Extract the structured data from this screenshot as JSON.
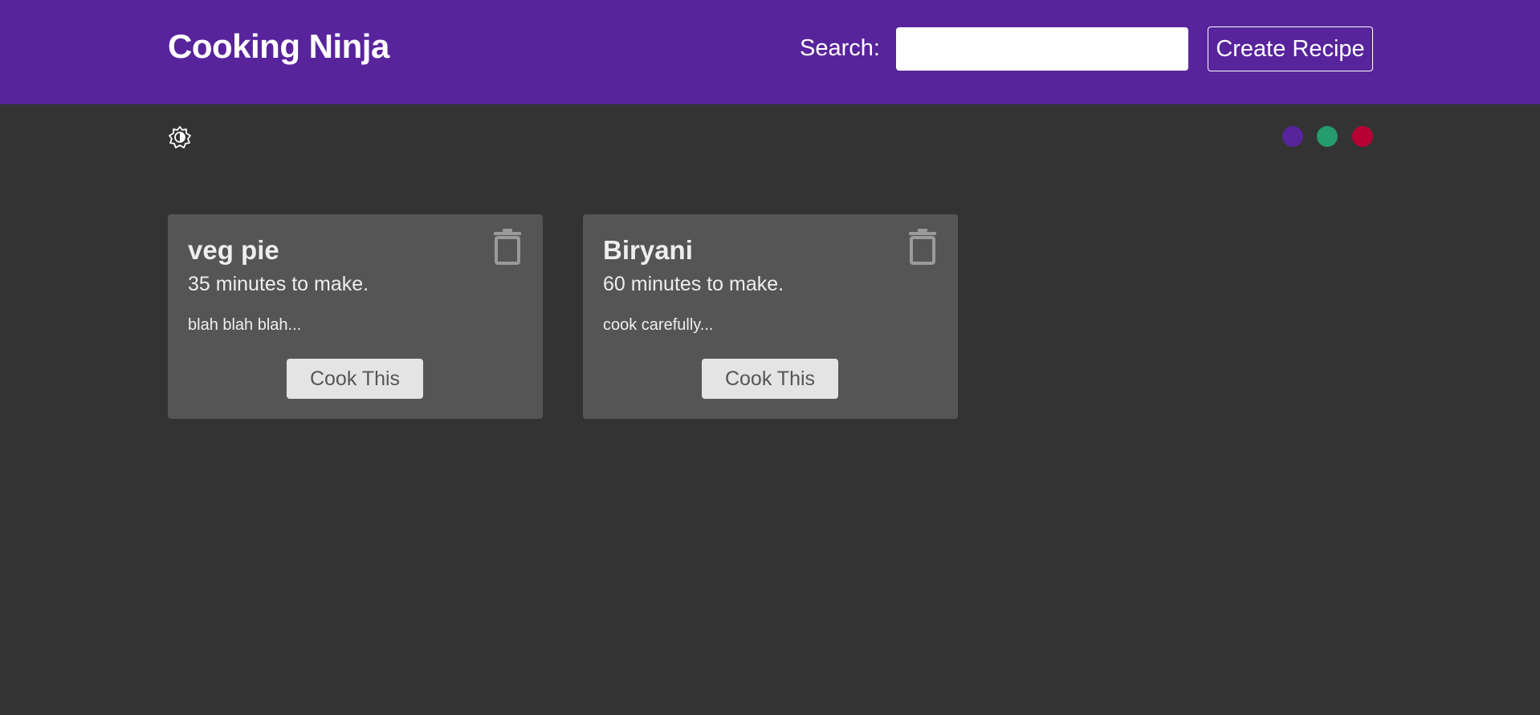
{
  "navbar": {
    "brand": "Cooking Ninja",
    "search_label": "Search:",
    "search_value": "",
    "search_placeholder": "",
    "create_label": "Create Recipe"
  },
  "theme": {
    "mode_icon": "brightness-icon",
    "swatches": [
      {
        "name": "purple",
        "color": "#58249c"
      },
      {
        "name": "green",
        "color": "#249c6b"
      },
      {
        "name": "red",
        "color": "#b70233"
      }
    ]
  },
  "recipes": [
    {
      "title": "veg pie",
      "time": "35 minutes to make.",
      "method": "blah blah blah...",
      "button": "Cook This",
      "delete_icon": "trash-icon"
    },
    {
      "title": "Biryani",
      "time": "60 minutes to make.",
      "method": "cook carefully...",
      "button": "Cook This",
      "delete_icon": "trash-icon"
    }
  ],
  "colors": {
    "navbar_bg": "#58249c",
    "page_bg": "#333333",
    "card_bg": "#555555",
    "button_bg": "#e4e4e4"
  }
}
